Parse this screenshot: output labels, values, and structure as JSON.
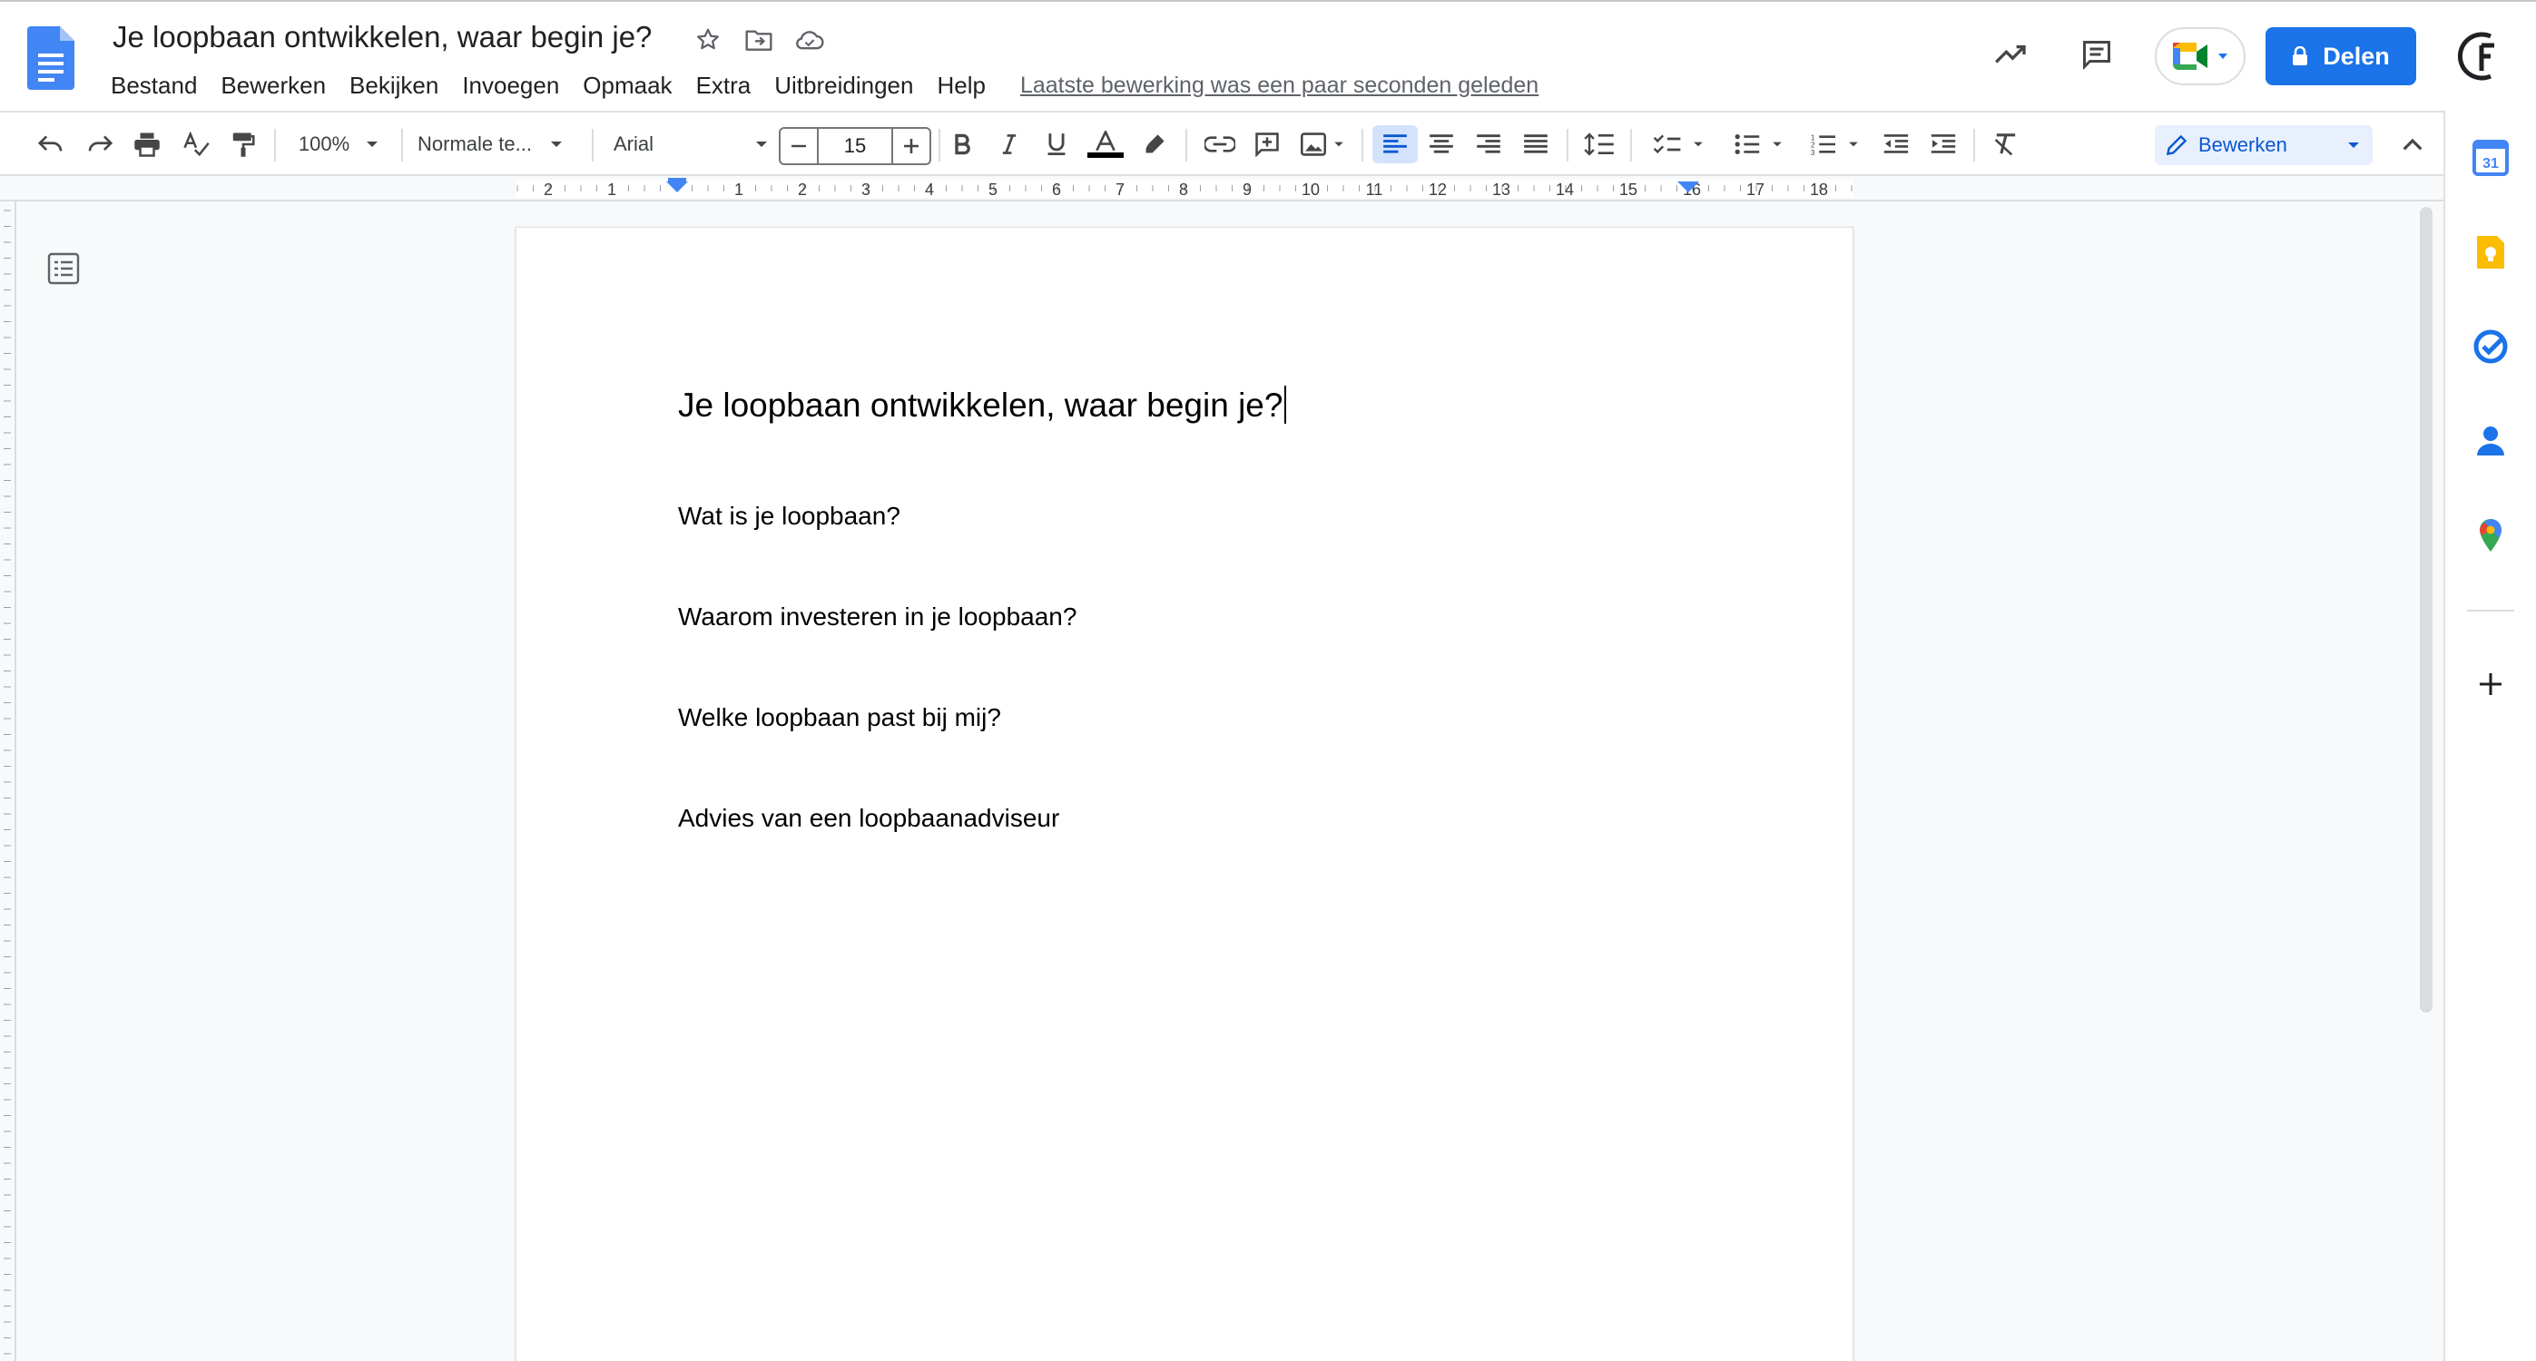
{
  "header": {
    "doc_title": "Je loopbaan ontwikkelen, waar begin je?",
    "menu": [
      "Bestand",
      "Bewerken",
      "Bekijken",
      "Invoegen",
      "Opmaak",
      "Extra",
      "Uitbreidingen",
      "Help"
    ],
    "last_edit": "Laatste bewerking was een paar seconden geleden",
    "share_label": "Delen",
    "icons": [
      "docs-logo",
      "star-icon",
      "move-folder-icon",
      "cloud-status-icon",
      "activity-trend-icon",
      "comments-icon",
      "meet-icon",
      "lock-icon",
      "account-avatar"
    ]
  },
  "toolbar": {
    "zoom": "100%",
    "style": "Normale te...",
    "font": "Arial",
    "font_size": "15",
    "edit_mode": "Bewerken",
    "brand_blue": "#1a73e8",
    "active_bg": "#d3e3fd"
  },
  "ruler": {
    "labels": [
      "2",
      "1",
      "1",
      "2",
      "3",
      "4",
      "5",
      "6",
      "7",
      "8",
      "9",
      "10",
      "11",
      "12",
      "13",
      "14",
      "15",
      "16",
      "17",
      "18"
    ]
  },
  "document": {
    "heading": "Je loopbaan ontwikkelen, waar begin je?",
    "lines": [
      "Wat is je loopbaan?",
      "Waarom investeren in je loopbaan?",
      "Welke loopbaan past bij mij?",
      "Advies van een loopbaanadviseur"
    ]
  },
  "side_panel": {
    "calendar_day": "31",
    "icons": [
      "calendar-icon",
      "keep-icon",
      "tasks-icon",
      "contacts-icon",
      "maps-icon",
      "add-icon"
    ]
  }
}
